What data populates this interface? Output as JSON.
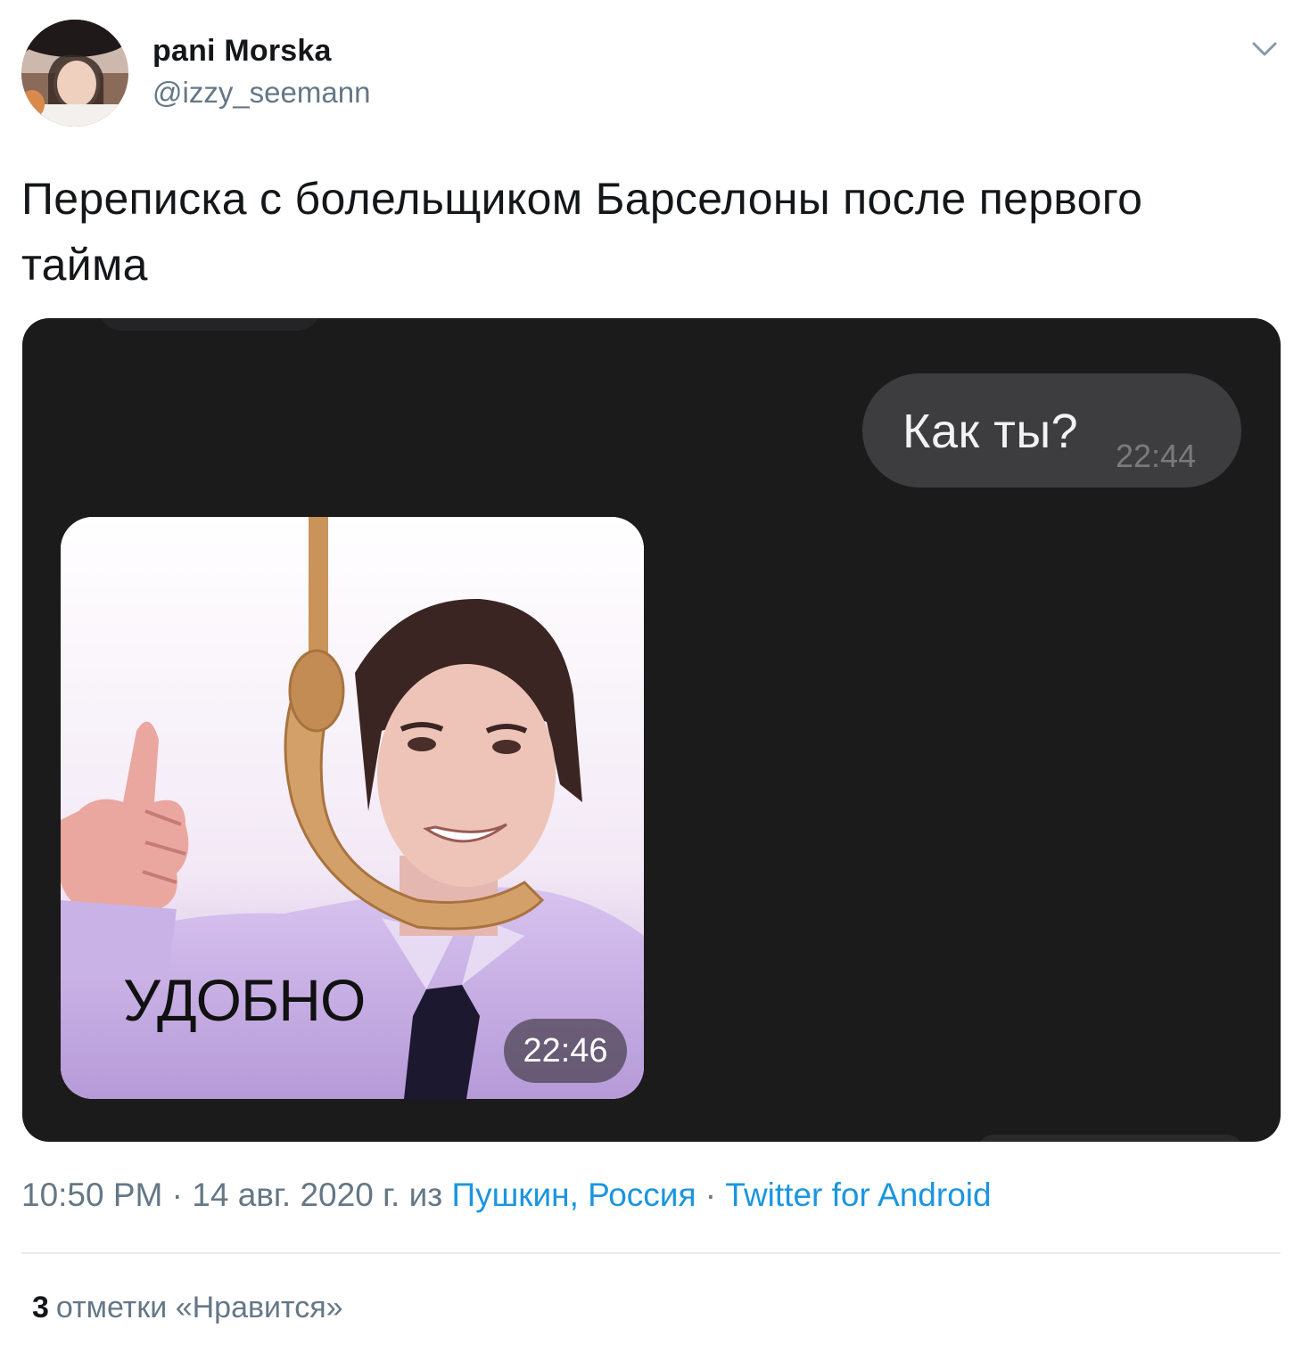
{
  "author": {
    "display_name": "pani Morska",
    "handle": "@izzy_seemann",
    "avatar_icon": "user-avatar-photo"
  },
  "tweet": {
    "text": "Переписка с болельщиком Барселоны после первого тайма"
  },
  "media": {
    "chat": {
      "outgoing_message": {
        "text": "Как ты?",
        "time": "22:44"
      },
      "incoming_sticker": {
        "caption": "УДОБНО",
        "time": "22:46"
      }
    }
  },
  "meta": {
    "time": "10:50 PM",
    "sep1": " · ",
    "date": "14 авг. 2020 г.",
    "from": " из ",
    "location": "Пушкин, Россия",
    "sep2": " · ",
    "source": "Twitter for Android"
  },
  "likes": {
    "count": "3",
    "label": "отметки «Нравится»"
  },
  "colors": {
    "link": "#1b95e0",
    "muted": "#657786",
    "chat_background": "#1b1b1c",
    "bubble": "#3d3d3f"
  }
}
